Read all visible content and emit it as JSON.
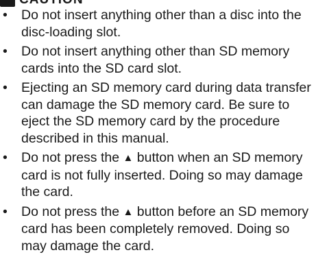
{
  "header": {
    "title": "CAUTION",
    "icon": "caution-warning-icon"
  },
  "items": [
    {
      "parts": [
        "Do not insert anything other than a disc into the disc-loading slot."
      ]
    },
    {
      "parts": [
        "Do not insert anything other than SD memory cards into the SD card slot."
      ]
    },
    {
      "parts": [
        "Ejecting an SD memory card during data transfer can damage the SD memory card. Be sure to eject the SD memory card by the procedure described in this manual."
      ]
    },
    {
      "before": "Do not press the ",
      "glyph": "▲",
      "after": " button when an SD memory card is not fully inserted. Doing so may damage the card."
    },
    {
      "before": "Do not press the ",
      "glyph": "▲",
      "after": " button before an SD memory card has been completely removed. Doing so may damage the card."
    }
  ],
  "bullet": "•"
}
